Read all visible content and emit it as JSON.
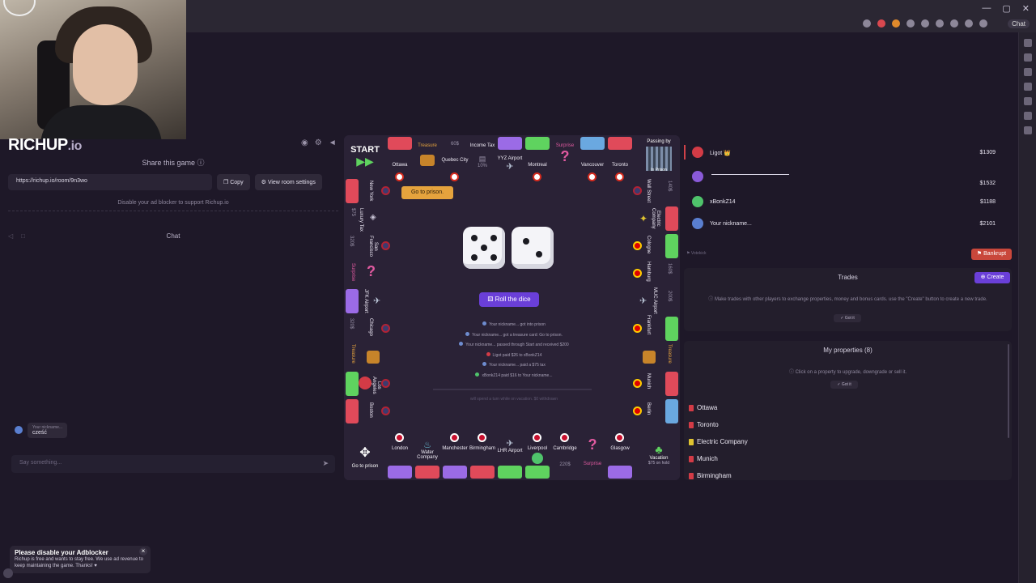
{
  "logo": {
    "main": "RICHUP",
    "suffix": ".io"
  },
  "share": {
    "title": "Share this game",
    "url": "https://richup.io/room/9n3wo",
    "copy_label": "Copy",
    "settings_label": "View room settings",
    "adblock_note": "Disable your ad blocker to support Richup.io"
  },
  "chat": {
    "title": "Chat",
    "message_author": "Your nickname...",
    "message_text": "cześć",
    "input_placeholder": "Say something..."
  },
  "ad_toast": {
    "title": "Please disable your Adblocker",
    "body": "Richup is free and wants to stay free. We use ad revenue to keep maintaining the game. Thanks! ♥",
    "close": "×"
  },
  "board": {
    "start": "START",
    "go_to_prison": "Go to prison",
    "passing_by": "Passing by",
    "in_prison": "In Prison",
    "vacation": "Vacation",
    "vacation_hold": "$75 on hold",
    "top_tiles": [
      {
        "name": "Ottawa",
        "color": "#e04a5a"
      },
      {
        "name": "Treasure",
        "color": ""
      },
      {
        "name": "Quebec City",
        "color": ""
      },
      {
        "name": "Income Tax",
        "color": ""
      },
      {
        "name": "YYZ Airport",
        "color": ""
      },
      {
        "name": "Montreal",
        "color": "#5fd35f"
      },
      {
        "name": "Surprise",
        "color": ""
      },
      {
        "name": "Vancouver",
        "color": "#6aa8e0"
      },
      {
        "name": "Toronto",
        "color": "#e04a5a"
      }
    ],
    "top_prices": {
      "quebec": "60$",
      "income": "10%"
    },
    "bottom_tiles": [
      {
        "name": "London",
        "color": "#9b6be6"
      },
      {
        "name": "Water Company",
        "color": ""
      },
      {
        "name": "Manchester",
        "color": "#9b6be6"
      },
      {
        "name": "Birmingham",
        "color": "#e04a5a"
      },
      {
        "name": "LHR Airport",
        "color": ""
      },
      {
        "name": "Liverpool",
        "color": "#5fd35f"
      },
      {
        "name": "Cambridge",
        "color": "#5fd35f"
      },
      {
        "name": "Surprise",
        "color": ""
      },
      {
        "name": "Glasgow",
        "color": "#9b6be6"
      }
    ],
    "bottom_price": "220$",
    "left_tiles": [
      {
        "name": "New York",
        "color": "#e04a5a"
      },
      {
        "name": "Luxury Tax",
        "color": ""
      },
      {
        "name": "San Francisco",
        "color": ""
      },
      {
        "name": "Surprise",
        "color": ""
      },
      {
        "name": "JFK Airport",
        "color": "#9b6be6"
      },
      {
        "name": "Chicago",
        "color": ""
      },
      {
        "name": "Treasure",
        "color": ""
      },
      {
        "name": "Los Angeles",
        "color": "#5fd35f"
      },
      {
        "name": "Boston",
        "color": "#e04a5a"
      }
    ],
    "left_prices": {
      "luxury": "$75",
      "sf": "320$",
      "chicago": "320$"
    },
    "right_tiles": [
      {
        "name": "Wall Street",
        "color": ""
      },
      {
        "name": "Electric Company",
        "color": "#e04a5a"
      },
      {
        "name": "Cologne",
        "color": "#5fd35f"
      },
      {
        "name": "Hamburg",
        "color": ""
      },
      {
        "name": "MUC Airport",
        "color": ""
      },
      {
        "name": "Frankfurt",
        "color": "#5fd35f"
      },
      {
        "name": "Treasure",
        "color": ""
      },
      {
        "name": "Munich",
        "color": "#e04a5a"
      },
      {
        "name": "Berlin",
        "color": "#6aa8e0"
      }
    ],
    "right_prices": {
      "wall": "140$",
      "hamburg": "160$",
      "muc": "200$"
    }
  },
  "center": {
    "prison_popup": "Go to prison.",
    "roll_label": "Roll the dice",
    "log": [
      "Your nickname... got into prison",
      "Your nickname... got a treasure card: Go to prison.",
      "Your nickname... passed through Start and received $200",
      "Ligot paid $26 to xBonkZ14",
      "Your nickname... paid a $75 tax",
      "xBonkZ14 paid $16 to Your nickname..."
    ],
    "vacation_note": "will spend a turn while on vacation. $0 withdrawn"
  },
  "players": [
    {
      "name": "Ligot 👑",
      "money": "$1309",
      "color": "#e04a5a"
    },
    {
      "name": "",
      "money": "$1532",
      "color": "#8a5ad8"
    },
    {
      "name": "xBonkZ14",
      "money": "$1188",
      "color": "#4fc36b"
    },
    {
      "name": "Your nickname...",
      "money": "$2101",
      "color": "#5a7fd0"
    }
  ],
  "votekick": "Votekick",
  "bankrupt_label": "Bankrupt",
  "trades": {
    "title": "Trades",
    "create_label": "Create",
    "info": "Make trades with other players to exchange properties, money and bonus cards. use the \"Create\" button to create a new trade.",
    "got_it": "Got it"
  },
  "properties": {
    "title": "My properties (8)",
    "info": "Click on a property to upgrade, downgrade or sell it.",
    "got_it": "Got it",
    "items": [
      {
        "name": "Ottawa",
        "color": "#e04a5a"
      },
      {
        "name": "Toronto",
        "color": "#e04a5a"
      },
      {
        "name": "Electric Company",
        "color": "#e0c430"
      },
      {
        "name": "Munich",
        "color": "#e04a5a"
      },
      {
        "name": "Birmingham",
        "color": "#e04a5a"
      }
    ]
  },
  "browser": {
    "chat_pill": "Chat"
  }
}
